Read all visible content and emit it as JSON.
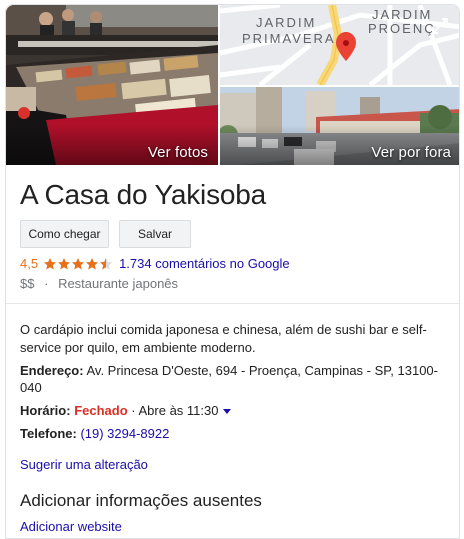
{
  "photos": {
    "see_photos_label": "Ver fotos",
    "see_outside_label": "Ver por fora",
    "map_labels": [
      "JARDIM",
      "PRIMAVERA",
      "JARDIM",
      "PROENÇ"
    ]
  },
  "place": {
    "name": "A Casa do Yakisoba",
    "rating": "4,5",
    "stars_value": 4.5,
    "stars_max": 5,
    "reviews_label": "1.734 comentários no Google",
    "price": "$$",
    "separator": "·",
    "category": "Restaurante japonês"
  },
  "actions": {
    "directions_label": "Como chegar",
    "save_label": "Salvar"
  },
  "details": {
    "description": "O cardápio inclui comida japonesa e chinesa, além de sushi bar e self-service por quilo, em ambiente moderno.",
    "address_label": "Endereço:",
    "address_value": "Av. Princesa D'Oeste, 694 - Proença, Campinas - SP, 13100-040",
    "hours_label": "Horário:",
    "hours_status": "Fechado",
    "hours_next": "· Abre às 11:30",
    "phone_label": "Telefone:",
    "phone_value": "(19) 3294-8922"
  },
  "links": {
    "suggest_edit": "Sugerir uma alteração",
    "missing_info_title": "Adicionar informações ausentes",
    "add_website": "Adicionar website"
  },
  "colors": {
    "star": "#e7711b",
    "link": "#1a0dab",
    "closed": "#d93025",
    "map_pin": "#ea4335"
  }
}
